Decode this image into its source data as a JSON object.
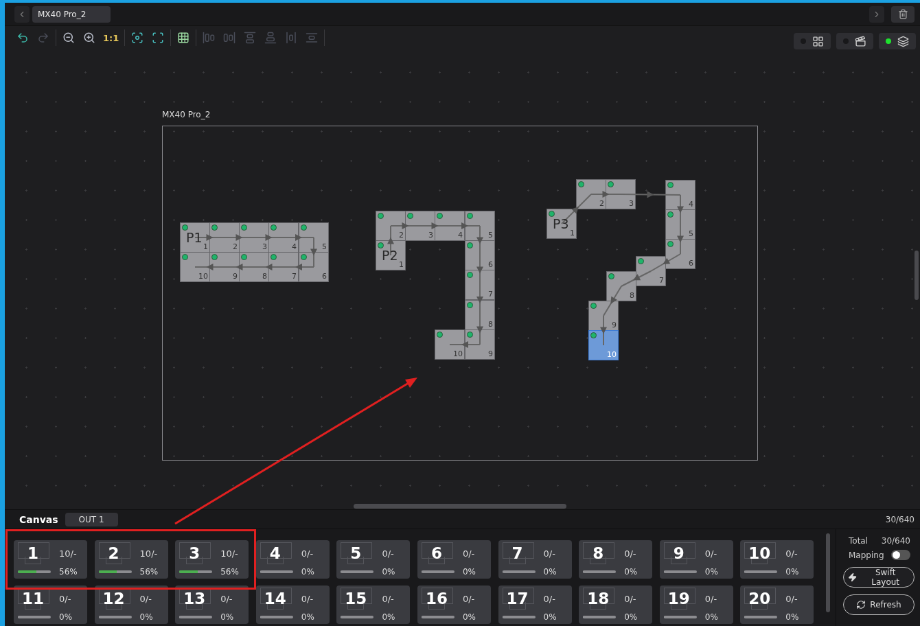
{
  "top_bar": {
    "tab": "MX40 Pro_2"
  },
  "toolbar": [
    [
      {
        "kind": "undo",
        "disabled": false
      },
      {
        "kind": "redo",
        "disabled": true
      }
    ],
    [
      {
        "kind": "zoom-out",
        "disabled": false
      },
      {
        "kind": "zoom-in",
        "disabled": false
      },
      {
        "kind": "actual-size",
        "label": "1:1",
        "disabled": false
      }
    ],
    [
      {
        "kind": "fit",
        "disabled": false
      },
      {
        "kind": "fill",
        "disabled": false
      }
    ],
    [
      {
        "kind": "grid",
        "disabled": false
      }
    ],
    [
      {
        "kind": "align-left",
        "disabled": true
      },
      {
        "kind": "align-right",
        "disabled": true
      },
      {
        "kind": "align-top",
        "disabled": true
      },
      {
        "kind": "align-bottom",
        "disabled": true
      },
      {
        "kind": "distribute-h",
        "disabled": true
      },
      {
        "kind": "distribute-v",
        "disabled": true
      }
    ]
  ],
  "view_toggles": [
    {
      "kind": "layout",
      "on": false
    },
    {
      "kind": "video",
      "on": false
    },
    {
      "kind": "layers",
      "on": true
    }
  ],
  "canvas": {
    "title": "MX40 Pro_2",
    "groups": [
      {
        "label": "P1",
        "tiles": [
          {
            "number": "1",
            "selected": false
          },
          {
            "number": "2",
            "selected": false
          },
          {
            "number": "3",
            "selected": false
          },
          {
            "number": "4",
            "selected": false
          },
          {
            "number": "5",
            "selected": false
          },
          {
            "number": "10",
            "selected": false
          },
          {
            "number": "9",
            "selected": false
          },
          {
            "number": "8",
            "selected": false
          },
          {
            "number": "7",
            "selected": false
          },
          {
            "number": "6",
            "selected": false
          }
        ]
      },
      {
        "label": "P2",
        "tiles": [
          {
            "number": "1",
            "selected": false
          },
          {
            "number": "2",
            "selected": false
          },
          {
            "number": "3",
            "selected": false
          },
          {
            "number": "4",
            "selected": false
          },
          {
            "number": "5",
            "selected": false
          },
          {
            "number": "6",
            "selected": false
          },
          {
            "number": "7",
            "selected": false
          },
          {
            "number": "8",
            "selected": false
          },
          {
            "number": "9",
            "selected": false
          },
          {
            "number": "10",
            "selected": false
          }
        ]
      },
      {
        "label": "P3",
        "tiles": [
          {
            "number": "1",
            "selected": false
          },
          {
            "number": "2",
            "selected": false
          },
          {
            "number": "3",
            "selected": false
          },
          {
            "number": "4",
            "selected": false
          },
          {
            "number": "5",
            "selected": false
          },
          {
            "number": "6",
            "selected": false
          },
          {
            "number": "7",
            "selected": false
          },
          {
            "number": "8",
            "selected": false
          },
          {
            "number": "9",
            "selected": false
          },
          {
            "number": "10",
            "selected": true
          }
        ]
      }
    ]
  },
  "bottom": {
    "title": "Canvas",
    "output_tab": "OUT 1",
    "count": "30/640",
    "ports": [
      {
        "number": "1",
        "count": "10/-",
        "level": 0.56,
        "percent": "56%"
      },
      {
        "number": "2",
        "count": "10/-",
        "level": 0.56,
        "percent": "56%"
      },
      {
        "number": "3",
        "count": "10/-",
        "level": 0.56,
        "percent": "56%"
      },
      {
        "number": "4",
        "count": "0/-",
        "level": 0,
        "percent": "0%"
      },
      {
        "number": "5",
        "count": "0/-",
        "level": 0,
        "percent": "0%"
      },
      {
        "number": "6",
        "count": "0/-",
        "level": 0,
        "percent": "0%"
      },
      {
        "number": "7",
        "count": "0/-",
        "level": 0,
        "percent": "0%"
      },
      {
        "number": "8",
        "count": "0/-",
        "level": 0,
        "percent": "0%"
      },
      {
        "number": "9",
        "count": "0/-",
        "level": 0,
        "percent": "0%"
      },
      {
        "number": "10",
        "count": "0/-",
        "level": 0,
        "percent": "0%"
      },
      {
        "number": "11",
        "count": "0/-",
        "level": 0,
        "percent": "0%"
      },
      {
        "number": "12",
        "count": "0/-",
        "level": 0,
        "percent": "0%"
      },
      {
        "number": "13",
        "count": "0/-",
        "level": 0,
        "percent": "0%"
      },
      {
        "number": "14",
        "count": "0/-",
        "level": 0,
        "percent": "0%"
      },
      {
        "number": "15",
        "count": "0/-",
        "level": 0,
        "percent": "0%"
      },
      {
        "number": "16",
        "count": "0/-",
        "level": 0,
        "percent": "0%"
      },
      {
        "number": "17",
        "count": "0/-",
        "level": 0,
        "percent": "0%"
      },
      {
        "number": "18",
        "count": "0/-",
        "level": 0,
        "percent": "0%"
      },
      {
        "number": "19",
        "count": "0/-",
        "level": 0,
        "percent": "0%"
      },
      {
        "number": "20",
        "count": "0/-",
        "level": 0,
        "percent": "0%"
      }
    ],
    "side": {
      "total_label": "Total",
      "total_value": "30/640",
      "mapping_label": "Mapping",
      "mapping_on": false,
      "buttons": [
        {
          "kind": "swift",
          "label": "Swift Layout"
        },
        {
          "kind": "refresh",
          "label": "Refresh"
        }
      ]
    }
  }
}
